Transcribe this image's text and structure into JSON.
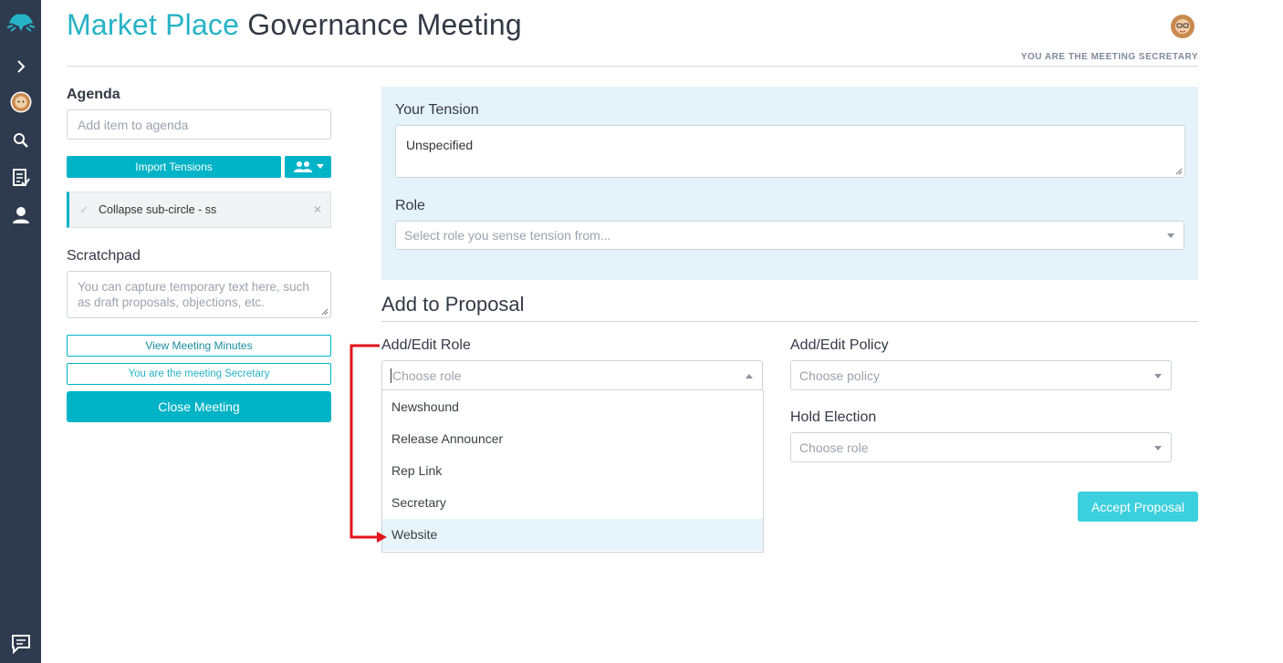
{
  "page": {
    "title_brand": "Market Place",
    "title_rest": "Governance Meeting",
    "role_notice": "YOU ARE THE MEETING SECRETARY"
  },
  "sidebar": {
    "icons": [
      "logo-frog-icon",
      "chevron-right-icon",
      "user-avatar-icon",
      "search-icon",
      "checklist-icon",
      "profile-icon",
      "chat-icon"
    ]
  },
  "agenda": {
    "heading": "Agenda",
    "add_placeholder": "Add item to agenda",
    "import_button": "Import Tensions",
    "items": [
      {
        "label": "Collapse sub-circle - ss"
      }
    ]
  },
  "scratchpad": {
    "heading": "Scratchpad",
    "placeholder": "You can capture temporary text here, such as draft proposals, objections, etc."
  },
  "actions": {
    "view_minutes": "View Meeting Minutes",
    "secretary_button": "You are the meeting Secretary",
    "close_meeting": "Close Meeting"
  },
  "tension": {
    "label": "Your Tension",
    "value": "Unspecified",
    "role_label": "Role",
    "role_placeholder": "Select role you sense tension from..."
  },
  "proposal": {
    "heading": "Add to Proposal",
    "add_edit_role_label": "Add/Edit Role",
    "add_edit_role_placeholder": "Choose role",
    "role_options": [
      "Newshound",
      "Release Announcer",
      "Rep Link",
      "Secretary",
      "Website"
    ],
    "highlighted_option": "Website",
    "add_edit_policy_label": "Add/Edit Policy",
    "add_edit_policy_placeholder": "Choose policy",
    "hold_election_label": "Hold Election",
    "hold_election_placeholder": "Choose role",
    "accept_button": "Accept Proposal"
  },
  "colors": {
    "brand": "#26b3c7",
    "button": "#00b3c6",
    "rail": "#2e3a4e",
    "panel": "#e4f2fa",
    "annotation": "#e3141b"
  }
}
